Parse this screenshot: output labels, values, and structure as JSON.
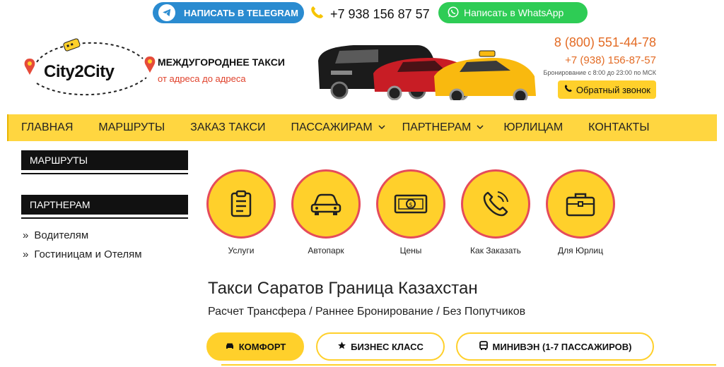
{
  "topbar": {
    "telegram_label": "НАПИСАТЬ В TELEGRAM",
    "phone": "+7 938 156 87 57",
    "whatsapp_label": "Написать в WhatsApp"
  },
  "header": {
    "logo_text": "City2City",
    "slogan_title": "МЕЖДУГОРОДНЕЕ ТАКСИ",
    "slogan_sub": "от адреса до адреса",
    "phone_main": "8 (800) 551-44-78",
    "phone_alt": "+7 (938) 156-87-57",
    "hours": "Бронирование с 8:00 до 23:00 по МСК",
    "callback_label": "Обратный звонок"
  },
  "nav": {
    "items": [
      {
        "label": "Главная"
      },
      {
        "label": "Маршруты"
      },
      {
        "label": "Заказ такси"
      },
      {
        "label": "Пассажирам"
      },
      {
        "label": "Партнерам"
      },
      {
        "label": "Юрлицам"
      },
      {
        "label": "Контакты"
      }
    ]
  },
  "sidebar": {
    "routes_title": "МАРШРУТЫ",
    "partners_title": "ПАРТНЕРАМ",
    "partner_links": [
      "Водителям",
      "Гостиницам и Отелям"
    ]
  },
  "features": [
    {
      "label": "Услуги",
      "icon": "clipboard-icon"
    },
    {
      "label": "Автопарк",
      "icon": "car-icon"
    },
    {
      "label": "Цены",
      "icon": "money-icon"
    },
    {
      "label": "Как Заказать",
      "icon": "phone-call-icon"
    },
    {
      "label": "Для Юрлиц",
      "icon": "briefcase-icon"
    }
  ],
  "main": {
    "title": "Такси Саратов Граница Казахстан",
    "subtitle": "Расчет Трансфера / Раннее Бронирование / Без Попутчиков"
  },
  "car_classes": [
    {
      "label": "Комфорт",
      "icon": "car-icon",
      "active": true
    },
    {
      "label": "Бизнес класс",
      "icon": "star-icon",
      "active": false
    },
    {
      "label": "Минивэн (1-7 пассажиров)",
      "icon": "bus-icon",
      "active": false
    }
  ],
  "colors": {
    "accent": "#ffd02b",
    "nav_bg": "#ffd640",
    "telegram": "#2a8bd0",
    "whatsapp": "#2ecc55",
    "orange_text": "#e36b24",
    "circle_border": "#e54b5b"
  }
}
